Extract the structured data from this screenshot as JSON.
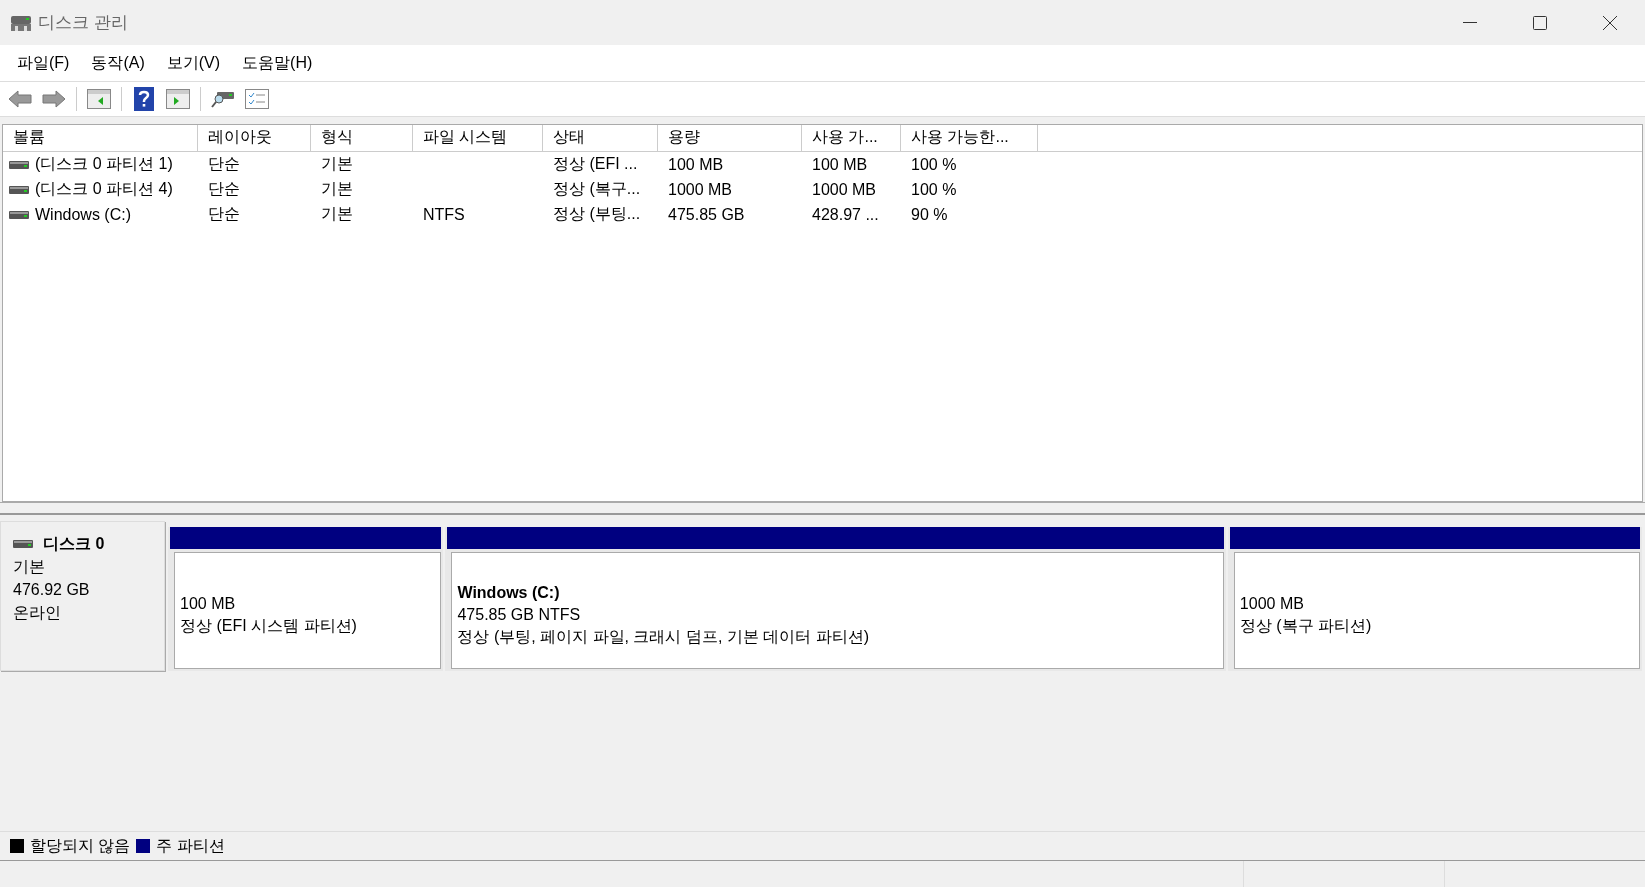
{
  "window": {
    "title": "디스크 관리"
  },
  "menu": [
    {
      "label": "파일(F)"
    },
    {
      "label": "동작(A)"
    },
    {
      "label": "보기(V)"
    },
    {
      "label": "도움말(H)"
    }
  ],
  "table": {
    "columns": [
      "볼륨",
      "레이아웃",
      "형식",
      "파일 시스템",
      "상태",
      "용량",
      "사용 가...",
      "사용 가능한..."
    ],
    "rows": [
      [
        "(디스크 0 파티션 1)",
        "단순",
        "기본",
        "",
        "정상 (EFI ...",
        "100 MB",
        "100 MB",
        "100 %"
      ],
      [
        "(디스크 0 파티션 4)",
        "단순",
        "기본",
        "",
        "정상 (복구...",
        "1000 MB",
        "1000 MB",
        "100 %"
      ],
      [
        "Windows (C:)",
        "단순",
        "기본",
        "NTFS",
        "정상 (부팅...",
        "475.85 GB",
        "428.97 ...",
        "90 %"
      ]
    ]
  },
  "disk": {
    "name": "디스크 0",
    "type": "기본",
    "size": "476.92 GB",
    "status": "온라인",
    "partitions": [
      {
        "size": "100 MB",
        "status": "정상 (EFI 시스템 파티션)"
      },
      {
        "title": "Windows  (C:)",
        "size": "475.85 GB NTFS",
        "status": "정상 (부팅, 페이지 파일, 크래시 덤프, 기본 데이터 파티션)"
      },
      {
        "size": "1000 MB",
        "status": "정상 (복구 파티션)"
      }
    ]
  },
  "legend": [
    {
      "label": "할당되지 않음",
      "color": "#000000"
    },
    {
      "label": "주 파티션",
      "color": "#000080"
    }
  ]
}
